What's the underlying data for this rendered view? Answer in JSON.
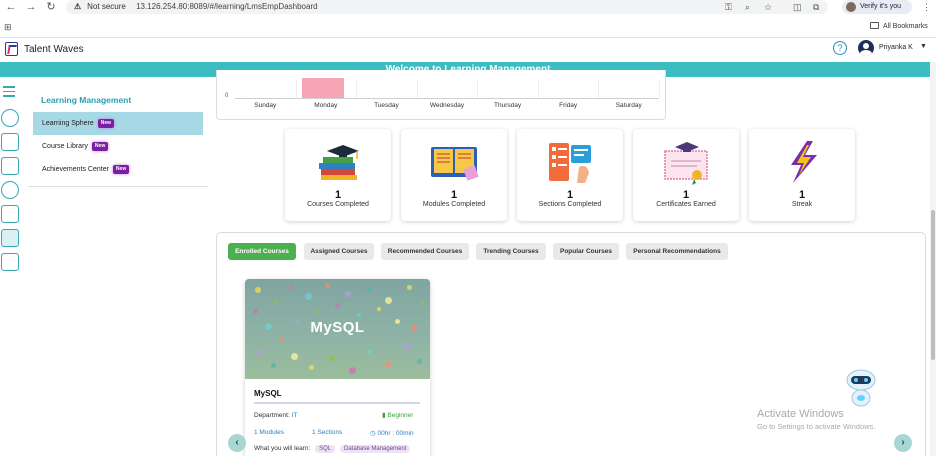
{
  "browser": {
    "security_label": "Not secure",
    "url": "13.126.254.80:8089/#/learning/LmsEmpDashboard",
    "profile_label": "Verify it's you",
    "bookmarks_label": "All Bookmarks"
  },
  "app": {
    "brand": "Talent Waves",
    "user_name": "Priyanka K",
    "banner_title": "Welcome to Learning Management"
  },
  "sidebar": {
    "title": "Learning Management",
    "items": [
      {
        "label": "Learning Sphere",
        "badge": "New",
        "active": true
      },
      {
        "label": "Course Library",
        "badge": "New",
        "active": false
      },
      {
        "label": "Achievements Center",
        "badge": "New",
        "active": false
      }
    ]
  },
  "chart_data": {
    "type": "bar",
    "categories": [
      "Sunday",
      "Monday",
      "Tuesday",
      "Wednesday",
      "Thursday",
      "Friday",
      "Saturday"
    ],
    "ytick_visible": "0",
    "bar_color": "#f7a5b5",
    "note": "only bottom of chart visible; Monday bar extends above view"
  },
  "stats": [
    {
      "value": "1",
      "label": "Courses Completed",
      "icon": "books-icon"
    },
    {
      "value": "1",
      "label": "Modules Completed",
      "icon": "open-book-icon"
    },
    {
      "value": "1",
      "label": "Sections Completed",
      "icon": "checklist-icon"
    },
    {
      "value": "1",
      "label": "Certificates Earned",
      "icon": "certificate-icon"
    },
    {
      "value": "1",
      "label": "Streak",
      "icon": "lightning-icon"
    }
  ],
  "tabs": [
    {
      "label": "Enrolled Courses",
      "active": true
    },
    {
      "label": "Assigned Courses",
      "active": false
    },
    {
      "label": "Recommended Courses",
      "active": false
    },
    {
      "label": "Trending Courses",
      "active": false
    },
    {
      "label": "Popular Courses",
      "active": false
    },
    {
      "label": "Personal Recommendations",
      "active": false
    }
  ],
  "course": {
    "image_title": "MySQL",
    "name": "MySQL",
    "department_label": "Department:",
    "department": "IT",
    "level": "Beginner",
    "modules": "1 Modules",
    "sections": "1 Sections",
    "duration": "00hr : 00min",
    "learn_label": "What you will learn:",
    "topics": [
      "SQL",
      "Database Management"
    ]
  },
  "watermark": {
    "line1": "Activate Windows",
    "line2": "Go to Settings to activate Windows."
  },
  "colors": {
    "accent": "#3bbdc2",
    "active_tab": "#4caf50",
    "badge": "#7a1fa2"
  }
}
